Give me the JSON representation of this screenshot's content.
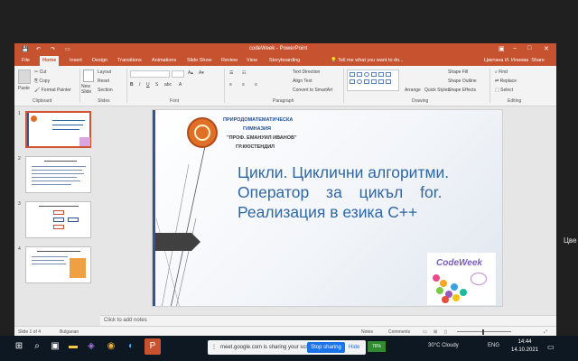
{
  "window": {
    "title": "codeWeek - PowerPoint"
  },
  "quick_access": [
    "save-icon",
    "undo-icon",
    "redo-icon",
    "present-icon"
  ],
  "window_controls": [
    "ribbon-options-icon",
    "minimize-icon",
    "maximize-icon",
    "close-icon"
  ],
  "tabs": [
    "File",
    "Home",
    "Insert",
    "Design",
    "Transitions",
    "Animations",
    "Slide Show",
    "Review",
    "View",
    "Storyboarding"
  ],
  "active_tab": "Home",
  "tell_me": "Tell me what you want to do...",
  "user": {
    "name": "Цветана И. Илиева",
    "share": "Share"
  },
  "ribbon": {
    "clipboard": {
      "paste": "Paste",
      "cut": "Cut",
      "copy": "Copy",
      "format_painter": "Format Painter",
      "label": "Clipboard"
    },
    "slides": {
      "new_slide": "New Slide",
      "layout": "Layout",
      "reset": "Reset",
      "section": "Section",
      "label": "Slides"
    },
    "font": {
      "label": "Font"
    },
    "paragraph": {
      "text_direction": "Text Direction",
      "align_text": "Align Text",
      "smartart": "Convert to SmartArt",
      "label": "Paragraph"
    },
    "drawing": {
      "arrange": "Arrange",
      "quick_styles": "Quick Styles",
      "shape_fill": "Shape Fill",
      "shape_outline": "Shape Outline",
      "shape_effects": "Shape Effects",
      "label": "Drawing"
    },
    "editing": {
      "find": "Find",
      "replace": "Replace",
      "select": "Select",
      "label": "Editing"
    }
  },
  "thumbnails": [
    {
      "number": "1",
      "selected": true
    },
    {
      "number": "2",
      "selected": false
    },
    {
      "number": "3",
      "selected": false
    },
    {
      "number": "4",
      "selected": false
    }
  ],
  "slide": {
    "school_line1": "ПРИРОДОМАТЕМАТИЧЕСКА",
    "school_line2": "ГИМНАЗИЯ",
    "school_line3": "\"ПРОФ. ЕМАНУИЛ ИВАНОВ\"",
    "school_line4": "ГР.КЮСТЕНДИЛ",
    "title_line1": "Цикли. Циклични алгоритми.",
    "title_line2": "Оператор за цикъл for.",
    "title_line3": "Реализация в езика C++",
    "codeweek_logo": "CodeWeek"
  },
  "notes_placeholder": "Click to add notes",
  "status": {
    "slide_counter": "Slide 1 of 4",
    "language": "Bulgarian",
    "notes": "Notes",
    "comments": "Comments"
  },
  "share_banner": {
    "message": "meet.google.com is sharing your screen.",
    "stop": "Stop sharing",
    "hide": "Hide"
  },
  "side_label": "Цве",
  "taskbar": {
    "apps": [
      "windows-icon",
      "search-icon",
      "task-view-icon",
      "file-explorer-icon",
      "visual-studio-icon",
      "chrome-icon",
      "edge-icon",
      "powerpoint-icon"
    ],
    "lang_indicator": "76%",
    "weather": "30°C Cloudy",
    "input_lang": "ENG",
    "time": "14:44",
    "date": "14.10.2021"
  }
}
